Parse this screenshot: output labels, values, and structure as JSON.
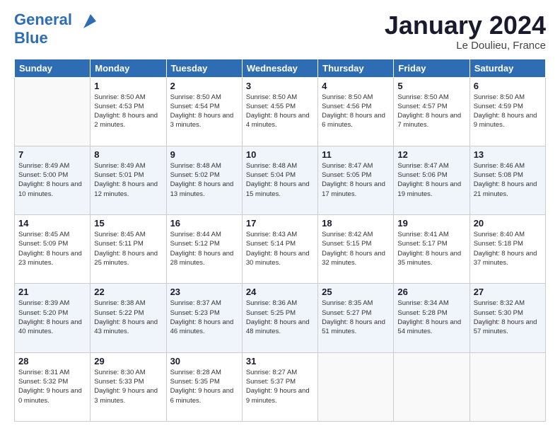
{
  "header": {
    "logo_line1": "General",
    "logo_line2": "Blue",
    "month_title": "January 2024",
    "location": "Le Doulieu, France"
  },
  "weekdays": [
    "Sunday",
    "Monday",
    "Tuesday",
    "Wednesday",
    "Thursday",
    "Friday",
    "Saturday"
  ],
  "weeks": [
    [
      {
        "day": "",
        "sunrise": "",
        "sunset": "",
        "daylight": ""
      },
      {
        "day": "1",
        "sunrise": "Sunrise: 8:50 AM",
        "sunset": "Sunset: 4:53 PM",
        "daylight": "Daylight: 8 hours and 2 minutes."
      },
      {
        "day": "2",
        "sunrise": "Sunrise: 8:50 AM",
        "sunset": "Sunset: 4:54 PM",
        "daylight": "Daylight: 8 hours and 3 minutes."
      },
      {
        "day": "3",
        "sunrise": "Sunrise: 8:50 AM",
        "sunset": "Sunset: 4:55 PM",
        "daylight": "Daylight: 8 hours and 4 minutes."
      },
      {
        "day": "4",
        "sunrise": "Sunrise: 8:50 AM",
        "sunset": "Sunset: 4:56 PM",
        "daylight": "Daylight: 8 hours and 6 minutes."
      },
      {
        "day": "5",
        "sunrise": "Sunrise: 8:50 AM",
        "sunset": "Sunset: 4:57 PM",
        "daylight": "Daylight: 8 hours and 7 minutes."
      },
      {
        "day": "6",
        "sunrise": "Sunrise: 8:50 AM",
        "sunset": "Sunset: 4:59 PM",
        "daylight": "Daylight: 8 hours and 9 minutes."
      }
    ],
    [
      {
        "day": "7",
        "sunrise": "Sunrise: 8:49 AM",
        "sunset": "Sunset: 5:00 PM",
        "daylight": "Daylight: 8 hours and 10 minutes."
      },
      {
        "day": "8",
        "sunrise": "Sunrise: 8:49 AM",
        "sunset": "Sunset: 5:01 PM",
        "daylight": "Daylight: 8 hours and 12 minutes."
      },
      {
        "day": "9",
        "sunrise": "Sunrise: 8:48 AM",
        "sunset": "Sunset: 5:02 PM",
        "daylight": "Daylight: 8 hours and 13 minutes."
      },
      {
        "day": "10",
        "sunrise": "Sunrise: 8:48 AM",
        "sunset": "Sunset: 5:04 PM",
        "daylight": "Daylight: 8 hours and 15 minutes."
      },
      {
        "day": "11",
        "sunrise": "Sunrise: 8:47 AM",
        "sunset": "Sunset: 5:05 PM",
        "daylight": "Daylight: 8 hours and 17 minutes."
      },
      {
        "day": "12",
        "sunrise": "Sunrise: 8:47 AM",
        "sunset": "Sunset: 5:06 PM",
        "daylight": "Daylight: 8 hours and 19 minutes."
      },
      {
        "day": "13",
        "sunrise": "Sunrise: 8:46 AM",
        "sunset": "Sunset: 5:08 PM",
        "daylight": "Daylight: 8 hours and 21 minutes."
      }
    ],
    [
      {
        "day": "14",
        "sunrise": "Sunrise: 8:45 AM",
        "sunset": "Sunset: 5:09 PM",
        "daylight": "Daylight: 8 hours and 23 minutes."
      },
      {
        "day": "15",
        "sunrise": "Sunrise: 8:45 AM",
        "sunset": "Sunset: 5:11 PM",
        "daylight": "Daylight: 8 hours and 25 minutes."
      },
      {
        "day": "16",
        "sunrise": "Sunrise: 8:44 AM",
        "sunset": "Sunset: 5:12 PM",
        "daylight": "Daylight: 8 hours and 28 minutes."
      },
      {
        "day": "17",
        "sunrise": "Sunrise: 8:43 AM",
        "sunset": "Sunset: 5:14 PM",
        "daylight": "Daylight: 8 hours and 30 minutes."
      },
      {
        "day": "18",
        "sunrise": "Sunrise: 8:42 AM",
        "sunset": "Sunset: 5:15 PM",
        "daylight": "Daylight: 8 hours and 32 minutes."
      },
      {
        "day": "19",
        "sunrise": "Sunrise: 8:41 AM",
        "sunset": "Sunset: 5:17 PM",
        "daylight": "Daylight: 8 hours and 35 minutes."
      },
      {
        "day": "20",
        "sunrise": "Sunrise: 8:40 AM",
        "sunset": "Sunset: 5:18 PM",
        "daylight": "Daylight: 8 hours and 37 minutes."
      }
    ],
    [
      {
        "day": "21",
        "sunrise": "Sunrise: 8:39 AM",
        "sunset": "Sunset: 5:20 PM",
        "daylight": "Daylight: 8 hours and 40 minutes."
      },
      {
        "day": "22",
        "sunrise": "Sunrise: 8:38 AM",
        "sunset": "Sunset: 5:22 PM",
        "daylight": "Daylight: 8 hours and 43 minutes."
      },
      {
        "day": "23",
        "sunrise": "Sunrise: 8:37 AM",
        "sunset": "Sunset: 5:23 PM",
        "daylight": "Daylight: 8 hours and 46 minutes."
      },
      {
        "day": "24",
        "sunrise": "Sunrise: 8:36 AM",
        "sunset": "Sunset: 5:25 PM",
        "daylight": "Daylight: 8 hours and 48 minutes."
      },
      {
        "day": "25",
        "sunrise": "Sunrise: 8:35 AM",
        "sunset": "Sunset: 5:27 PM",
        "daylight": "Daylight: 8 hours and 51 minutes."
      },
      {
        "day": "26",
        "sunrise": "Sunrise: 8:34 AM",
        "sunset": "Sunset: 5:28 PM",
        "daylight": "Daylight: 8 hours and 54 minutes."
      },
      {
        "day": "27",
        "sunrise": "Sunrise: 8:32 AM",
        "sunset": "Sunset: 5:30 PM",
        "daylight": "Daylight: 8 hours and 57 minutes."
      }
    ],
    [
      {
        "day": "28",
        "sunrise": "Sunrise: 8:31 AM",
        "sunset": "Sunset: 5:32 PM",
        "daylight": "Daylight: 9 hours and 0 minutes."
      },
      {
        "day": "29",
        "sunrise": "Sunrise: 8:30 AM",
        "sunset": "Sunset: 5:33 PM",
        "daylight": "Daylight: 9 hours and 3 minutes."
      },
      {
        "day": "30",
        "sunrise": "Sunrise: 8:28 AM",
        "sunset": "Sunset: 5:35 PM",
        "daylight": "Daylight: 9 hours and 6 minutes."
      },
      {
        "day": "31",
        "sunrise": "Sunrise: 8:27 AM",
        "sunset": "Sunset: 5:37 PM",
        "daylight": "Daylight: 9 hours and 9 minutes."
      },
      {
        "day": "",
        "sunrise": "",
        "sunset": "",
        "daylight": ""
      },
      {
        "day": "",
        "sunrise": "",
        "sunset": "",
        "daylight": ""
      },
      {
        "day": "",
        "sunrise": "",
        "sunset": "",
        "daylight": ""
      }
    ]
  ]
}
